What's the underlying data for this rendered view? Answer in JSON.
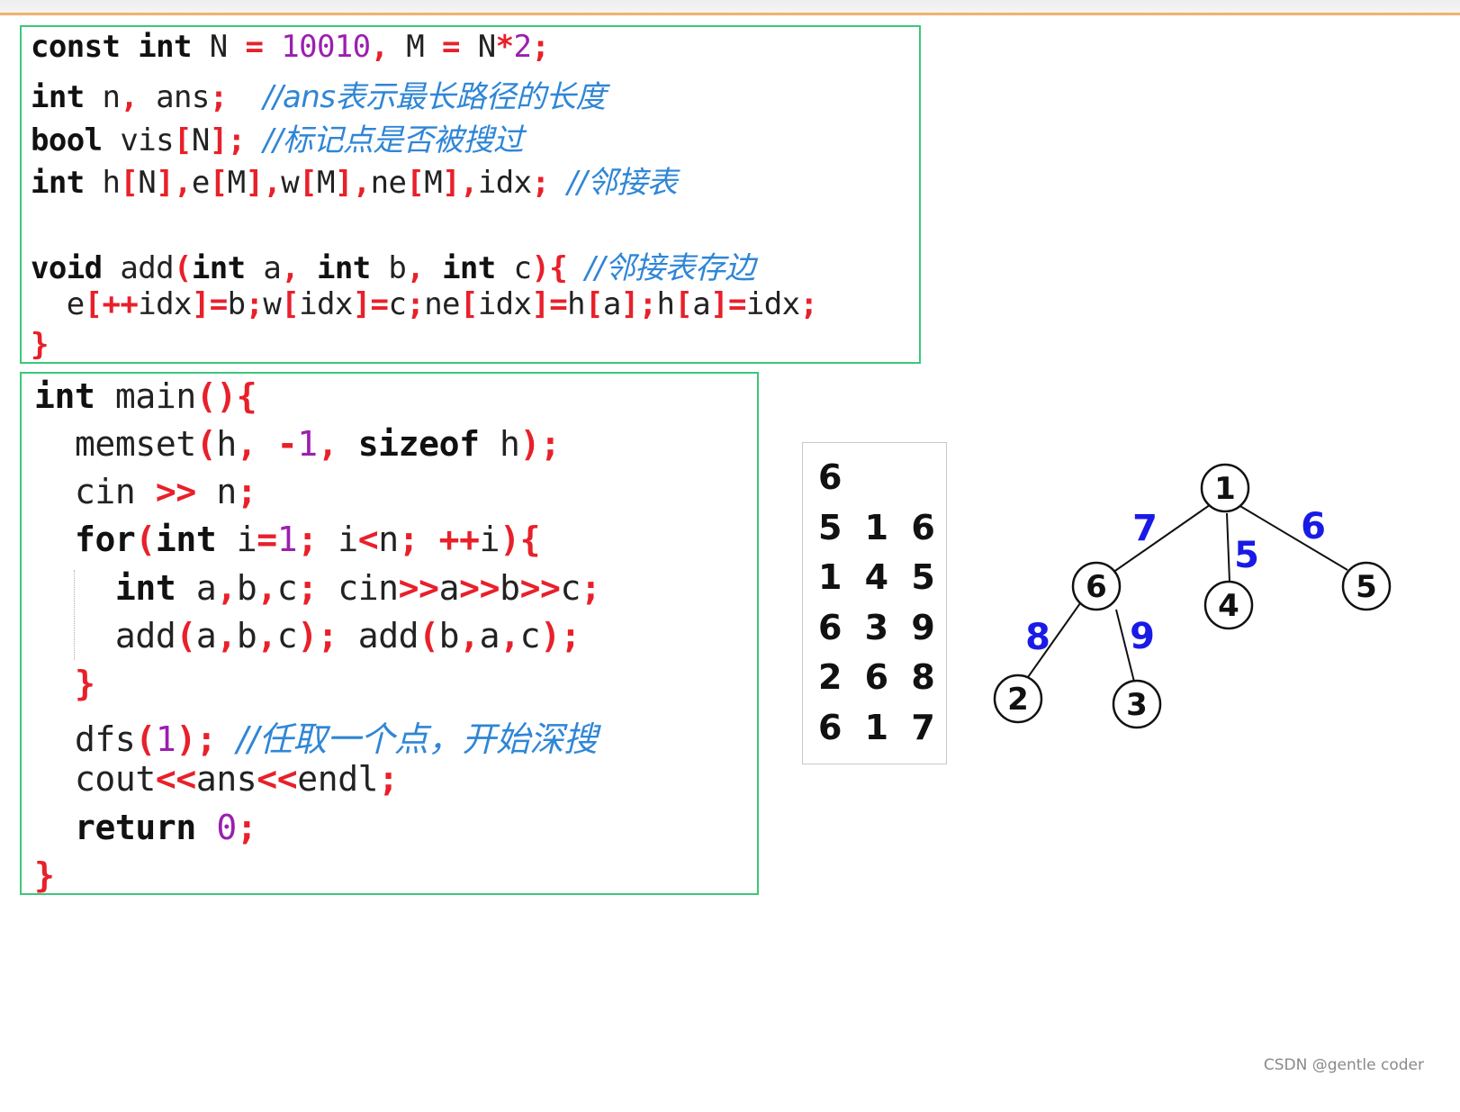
{
  "code_block_1": {
    "l1": [
      {
        "t": "const",
        "c": "kw"
      },
      {
        "t": " ",
        "c": "tx"
      },
      {
        "t": "int",
        "c": "kw"
      },
      {
        "t": " N ",
        "c": "tx"
      },
      {
        "t": "=",
        "c": "op"
      },
      {
        "t": " ",
        "c": "tx"
      },
      {
        "t": "10010",
        "c": "nm"
      },
      {
        "t": ",",
        "c": "op"
      },
      {
        "t": " M ",
        "c": "tx"
      },
      {
        "t": "=",
        "c": "op"
      },
      {
        "t": " N",
        "c": "tx"
      },
      {
        "t": "*",
        "c": "op"
      },
      {
        "t": "2",
        "c": "nm"
      },
      {
        "t": ";",
        "c": "op"
      }
    ],
    "l2": [
      {
        "t": "int",
        "c": "kw"
      },
      {
        "t": " n",
        "c": "tx"
      },
      {
        "t": ",",
        "c": "op"
      },
      {
        "t": " ans",
        "c": "tx"
      },
      {
        "t": ";",
        "c": "op"
      },
      {
        "t": "  ",
        "c": "tx"
      },
      {
        "t": "//ans表示最长路径的长度",
        "c": "cm"
      }
    ],
    "l3": [
      {
        "t": "bool",
        "c": "kw"
      },
      {
        "t": " vis",
        "c": "tx"
      },
      {
        "t": "[",
        "c": "op"
      },
      {
        "t": "N",
        "c": "tx"
      },
      {
        "t": "]",
        "c": "op"
      },
      {
        "t": ";",
        "c": "op"
      },
      {
        "t": " ",
        "c": "tx"
      },
      {
        "t": "//标记点是否被搜过",
        "c": "cm"
      }
    ],
    "l4": [
      {
        "t": "int",
        "c": "kw"
      },
      {
        "t": " h",
        "c": "tx"
      },
      {
        "t": "[",
        "c": "op"
      },
      {
        "t": "N",
        "c": "tx"
      },
      {
        "t": "],",
        "c": "op"
      },
      {
        "t": "e",
        "c": "tx"
      },
      {
        "t": "[",
        "c": "op"
      },
      {
        "t": "M",
        "c": "tx"
      },
      {
        "t": "],",
        "c": "op"
      },
      {
        "t": "w",
        "c": "tx"
      },
      {
        "t": "[",
        "c": "op"
      },
      {
        "t": "M",
        "c": "tx"
      },
      {
        "t": "],",
        "c": "op"
      },
      {
        "t": "ne",
        "c": "tx"
      },
      {
        "t": "[",
        "c": "op"
      },
      {
        "t": "M",
        "c": "tx"
      },
      {
        "t": "],",
        "c": "op"
      },
      {
        "t": "idx",
        "c": "tx"
      },
      {
        "t": ";",
        "c": "op"
      },
      {
        "t": " ",
        "c": "tx"
      },
      {
        "t": "//邻接表",
        "c": "cm"
      }
    ],
    "l5": [
      {
        "t": "void",
        "c": "kw"
      },
      {
        "t": " add",
        "c": "tx"
      },
      {
        "t": "(",
        "c": "op"
      },
      {
        "t": "int",
        "c": "kw"
      },
      {
        "t": " a",
        "c": "tx"
      },
      {
        "t": ",",
        "c": "op"
      },
      {
        "t": " ",
        "c": "tx"
      },
      {
        "t": "int",
        "c": "kw"
      },
      {
        "t": " b",
        "c": "tx"
      },
      {
        "t": ",",
        "c": "op"
      },
      {
        "t": " ",
        "c": "tx"
      },
      {
        "t": "int",
        "c": "kw"
      },
      {
        "t": " c",
        "c": "tx"
      },
      {
        "t": "){",
        "c": "op"
      },
      {
        "t": " ",
        "c": "tx"
      },
      {
        "t": "//邻接表存边",
        "c": "cm"
      }
    ],
    "l6": [
      {
        "t": "  e",
        "c": "tx"
      },
      {
        "t": "[++",
        "c": "op"
      },
      {
        "t": "idx",
        "c": "tx"
      },
      {
        "t": "]=",
        "c": "op"
      },
      {
        "t": "b",
        "c": "tx"
      },
      {
        "t": ";",
        "c": "op"
      },
      {
        "t": "w",
        "c": "tx"
      },
      {
        "t": "[",
        "c": "op"
      },
      {
        "t": "idx",
        "c": "tx"
      },
      {
        "t": "]=",
        "c": "op"
      },
      {
        "t": "c",
        "c": "tx"
      },
      {
        "t": ";",
        "c": "op"
      },
      {
        "t": "ne",
        "c": "tx"
      },
      {
        "t": "[",
        "c": "op"
      },
      {
        "t": "idx",
        "c": "tx"
      },
      {
        "t": "]=",
        "c": "op"
      },
      {
        "t": "h",
        "c": "tx"
      },
      {
        "t": "[",
        "c": "op"
      },
      {
        "t": "a",
        "c": "tx"
      },
      {
        "t": "];",
        "c": "op"
      },
      {
        "t": "h",
        "c": "tx"
      },
      {
        "t": "[",
        "c": "op"
      },
      {
        "t": "a",
        "c": "tx"
      },
      {
        "t": "]=",
        "c": "op"
      },
      {
        "t": "idx",
        "c": "tx"
      },
      {
        "t": ";",
        "c": "op"
      }
    ],
    "l7": [
      {
        "t": "}",
        "c": "op"
      }
    ]
  },
  "code_block_2": {
    "l1": [
      {
        "t": "int",
        "c": "kw"
      },
      {
        "t": " main",
        "c": "tx"
      },
      {
        "t": "(){",
        "c": "op"
      }
    ],
    "l2": [
      {
        "t": "  memset",
        "c": "tx"
      },
      {
        "t": "(",
        "c": "op"
      },
      {
        "t": "h",
        "c": "tx"
      },
      {
        "t": ",",
        "c": "op"
      },
      {
        "t": " ",
        "c": "tx"
      },
      {
        "t": "-",
        "c": "op"
      },
      {
        "t": "1",
        "c": "nm"
      },
      {
        "t": ",",
        "c": "op"
      },
      {
        "t": " ",
        "c": "tx"
      },
      {
        "t": "sizeof",
        "c": "kw"
      },
      {
        "t": " h",
        "c": "tx"
      },
      {
        "t": ");",
        "c": "op"
      }
    ],
    "l3": [
      {
        "t": "  cin ",
        "c": "tx"
      },
      {
        "t": ">>",
        "c": "op"
      },
      {
        "t": " n",
        "c": "tx"
      },
      {
        "t": ";",
        "c": "op"
      }
    ],
    "l4": [
      {
        "t": "  ",
        "c": "tx"
      },
      {
        "t": "for",
        "c": "kw"
      },
      {
        "t": "(",
        "c": "op"
      },
      {
        "t": "int",
        "c": "kw"
      },
      {
        "t": " i",
        "c": "tx"
      },
      {
        "t": "=",
        "c": "op"
      },
      {
        "t": "1",
        "c": "nm"
      },
      {
        "t": ";",
        "c": "op"
      },
      {
        "t": " i",
        "c": "tx"
      },
      {
        "t": "<",
        "c": "op"
      },
      {
        "t": "n",
        "c": "tx"
      },
      {
        "t": ";",
        "c": "op"
      },
      {
        "t": " ",
        "c": "tx"
      },
      {
        "t": "++",
        "c": "op"
      },
      {
        "t": "i",
        "c": "tx"
      },
      {
        "t": "){",
        "c": "op"
      }
    ],
    "l5": [
      {
        "t": "    ",
        "c": "tx"
      },
      {
        "t": "int",
        "c": "kw"
      },
      {
        "t": " a",
        "c": "tx"
      },
      {
        "t": ",",
        "c": "op"
      },
      {
        "t": "b",
        "c": "tx"
      },
      {
        "t": ",",
        "c": "op"
      },
      {
        "t": "c",
        "c": "tx"
      },
      {
        "t": ";",
        "c": "op"
      },
      {
        "t": " cin",
        "c": "tx"
      },
      {
        "t": ">>",
        "c": "op"
      },
      {
        "t": "a",
        "c": "tx"
      },
      {
        "t": ">>",
        "c": "op"
      },
      {
        "t": "b",
        "c": "tx"
      },
      {
        "t": ">>",
        "c": "op"
      },
      {
        "t": "c",
        "c": "tx"
      },
      {
        "t": ";",
        "c": "op"
      }
    ],
    "l6": [
      {
        "t": "    add",
        "c": "tx"
      },
      {
        "t": "(",
        "c": "op"
      },
      {
        "t": "a",
        "c": "tx"
      },
      {
        "t": ",",
        "c": "op"
      },
      {
        "t": "b",
        "c": "tx"
      },
      {
        "t": ",",
        "c": "op"
      },
      {
        "t": "c",
        "c": "tx"
      },
      {
        "t": ");",
        "c": "op"
      },
      {
        "t": " add",
        "c": "tx"
      },
      {
        "t": "(",
        "c": "op"
      },
      {
        "t": "b",
        "c": "tx"
      },
      {
        "t": ",",
        "c": "op"
      },
      {
        "t": "a",
        "c": "tx"
      },
      {
        "t": ",",
        "c": "op"
      },
      {
        "t": "c",
        "c": "tx"
      },
      {
        "t": ");",
        "c": "op"
      }
    ],
    "l7": [
      {
        "t": "  }",
        "c": "op"
      }
    ],
    "l8": [
      {
        "t": "  dfs",
        "c": "tx"
      },
      {
        "t": "(",
        "c": "op"
      },
      {
        "t": "1",
        "c": "nm"
      },
      {
        "t": ");",
        "c": "op"
      },
      {
        "t": " ",
        "c": "tx"
      },
      {
        "t": "//任取一个点，开始深搜",
        "c": "cm"
      }
    ],
    "l9": [
      {
        "t": "  cout",
        "c": "tx"
      },
      {
        "t": "<<",
        "c": "op"
      },
      {
        "t": "ans",
        "c": "tx"
      },
      {
        "t": "<<",
        "c": "op"
      },
      {
        "t": "endl",
        "c": "tx"
      },
      {
        "t": ";",
        "c": "op"
      }
    ],
    "l10": [
      {
        "t": "  ",
        "c": "tx"
      },
      {
        "t": "return",
        "c": "kw"
      },
      {
        "t": " ",
        "c": "tx"
      },
      {
        "t": "0",
        "c": "nm"
      },
      {
        "t": ";",
        "c": "op"
      }
    ],
    "l11": [
      {
        "t": "}",
        "c": "op"
      }
    ]
  },
  "input": {
    "line1": "6",
    "line2": "5 1 6",
    "line3": "1 4 5",
    "line4": "6 3 9",
    "line5": "2 6 8",
    "line6": "6 1 7"
  },
  "tree": {
    "nodes": {
      "n1": "1",
      "n2": "2",
      "n3": "3",
      "n4": "4",
      "n5": "5",
      "n6": "6"
    },
    "weights": {
      "w16": "7",
      "w14": "5",
      "w15": "6",
      "w62": "8",
      "w63": "9"
    },
    "weight_color": "#1a1ae6"
  },
  "watermark": "CSDN @gentle coder",
  "colors": {
    "keyword": "#111111",
    "operator": "#e8202a",
    "number": "#9b1fb0",
    "comment": "#2f86d6",
    "panel_border": "#3cc77a"
  }
}
